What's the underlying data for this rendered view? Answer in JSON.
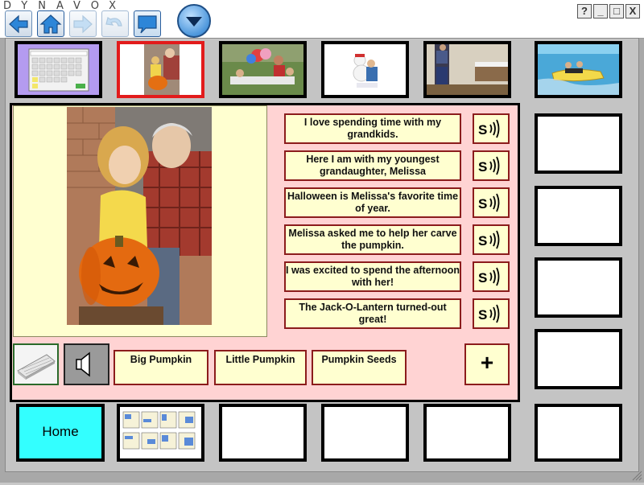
{
  "app": {
    "brand": "DYNAVOX"
  },
  "window_buttons": [
    "?",
    "_",
    "□",
    "X"
  ],
  "toolbar": {
    "buttons": [
      {
        "name": "back-arrow-icon"
      },
      {
        "name": "home-icon"
      },
      {
        "name": "forward-arrow-icon"
      },
      {
        "name": "undo-icon"
      },
      {
        "name": "speech-bubble-icon"
      },
      {
        "name": "menu-arrow-icon"
      }
    ]
  },
  "phrases": [
    "I love spending time with my grandkids.",
    "Here I am with my youngest grandaughter,  Melissa",
    "Halloween is Melissa's favorite time of year.",
    "Melissa asked me to help her carve the pumpkin.",
    "I was excited to spend the afternoon with her!",
    "The Jack-O-Lantern turned-out great!"
  ],
  "words": [
    "Big Pumpkin",
    "Little Pumpkin",
    "Pumpkin Seeds"
  ],
  "plus_label": "+",
  "home_label": "Home",
  "colors": {
    "panel": "#ffd3d3",
    "cell": "#ffffd0",
    "home": "#33ffff",
    "selected_border": "#e21b1b",
    "keypad_tile": "#b49bf0"
  }
}
